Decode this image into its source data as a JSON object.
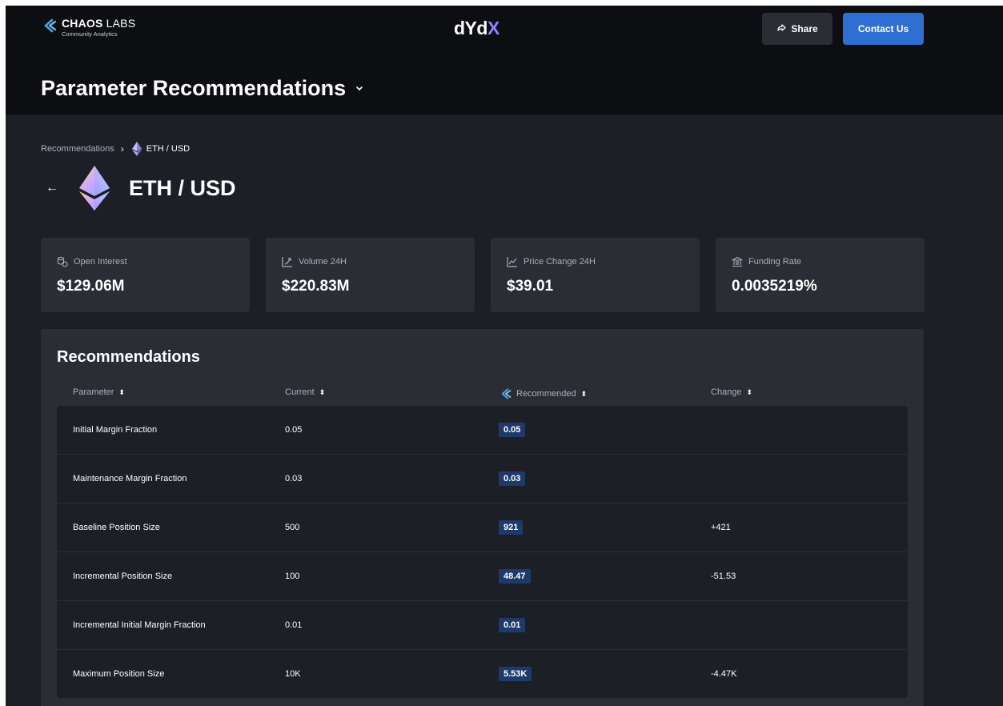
{
  "header": {
    "brand_name_bold": "CHAOS",
    "brand_name_rest": "LABS",
    "brand_sub": "Community Analytics",
    "center_logo_main": "dYdX",
    "share_label": "Share",
    "contact_label": "Contact Us"
  },
  "page": {
    "title": "Parameter Recommendations"
  },
  "breadcrumb": {
    "root": "Recommendations",
    "current": "ETH / USD"
  },
  "asset": {
    "title": "ETH / USD"
  },
  "stats": [
    {
      "label": "Open Interest",
      "value": "$129.06M",
      "icon": "coins-icon"
    },
    {
      "label": "Volume 24H",
      "value": "$220.83M",
      "icon": "volume-icon"
    },
    {
      "label": "Price Change 24H",
      "value": "$39.01",
      "icon": "price-chart-icon"
    },
    {
      "label": "Funding Rate",
      "value": "0.0035219%",
      "icon": "bank-icon"
    }
  ],
  "recommendations": {
    "title": "Recommendations",
    "columns": {
      "parameter": "Parameter",
      "current": "Current",
      "recommended": "Recommended",
      "change": "Change"
    },
    "rows": [
      {
        "parameter": "Initial Margin Fraction",
        "current": "0.05",
        "recommended": "0.05",
        "change": ""
      },
      {
        "parameter": "Maintenance Margin Fraction",
        "current": "0.03",
        "recommended": "0.03",
        "change": ""
      },
      {
        "parameter": "Baseline Position Size",
        "current": "500",
        "recommended": "921",
        "change": "+421"
      },
      {
        "parameter": "Incremental Position Size",
        "current": "100",
        "recommended": "48.47",
        "change": "-51.53"
      },
      {
        "parameter": "Incremental Initial Margin Fraction",
        "current": "0.01",
        "recommended": "0.01",
        "change": ""
      },
      {
        "parameter": "Maximum Position Size",
        "current": "10K",
        "recommended": "5.53K",
        "change": "-4.47K"
      }
    ]
  },
  "colors": {
    "accent": "#2f6ed3",
    "pill_bg": "#1e3a6b",
    "header_bg": "#0c0e12",
    "panel_bg": "#2a2d34"
  }
}
